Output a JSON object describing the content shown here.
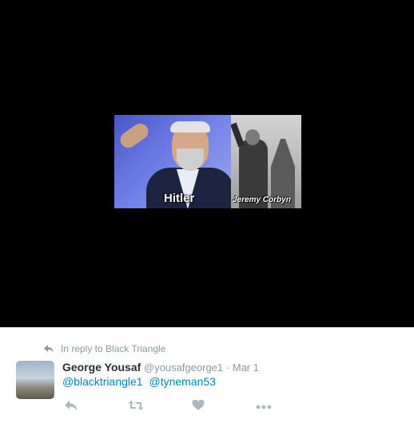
{
  "media": {
    "caption_left": "Hitler",
    "caption_right": "Jeremy Corbyn"
  },
  "reply": {
    "label": "In reply to Black Triangle"
  },
  "tweet": {
    "display_name": "George Yousaf",
    "handle": "@yousafgeorge1",
    "separator": "·",
    "timestamp": "Mar 1",
    "mentions": [
      "@blacktriangle1",
      "@tyneman53"
    ]
  },
  "actions": {
    "icons": [
      "reply-icon",
      "retweet-icon",
      "like-icon",
      "more-icon"
    ]
  },
  "colors": {
    "link": "#0084b4",
    "muted": "#8899a6",
    "name": "#292f33",
    "media_bg": "#000000"
  }
}
